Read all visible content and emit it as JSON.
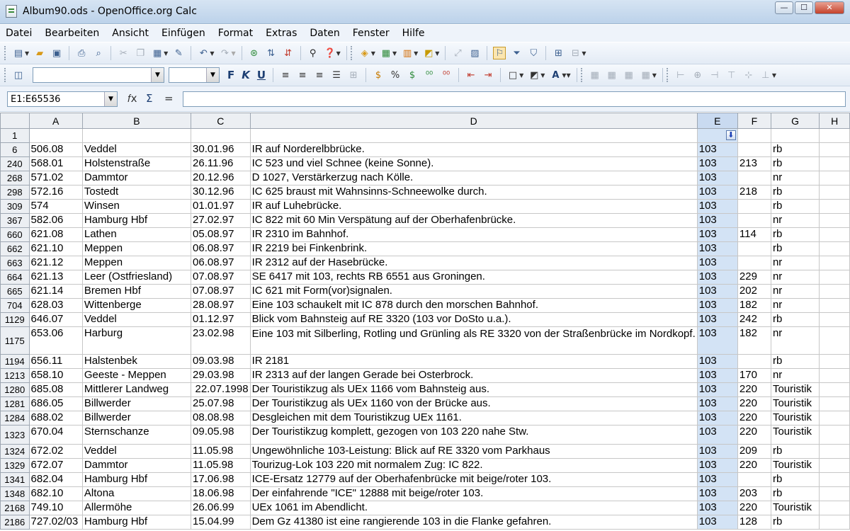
{
  "window": {
    "title": "Album90.ods - OpenOffice.org Calc",
    "min": "—",
    "max": "☐",
    "close": "✕"
  },
  "menu": [
    "Datei",
    "Bearbeiten",
    "Ansicht",
    "Einfügen",
    "Format",
    "Extras",
    "Daten",
    "Fenster",
    "Hilfe"
  ],
  "format": {
    "bold": "F",
    "italic": "K",
    "underline": "U"
  },
  "namebox": "E1:E65536",
  "formula": {
    "fx": "𝑓x",
    "sum": "Σ",
    "equals": "="
  },
  "columns": [
    "A",
    "B",
    "C",
    "D",
    "E",
    "F",
    "G",
    "H"
  ],
  "rows": [
    {
      "n": "1",
      "a": "",
      "b": "",
      "c": "",
      "d": "",
      "e": "",
      "f": "",
      "g": ""
    },
    {
      "n": "6",
      "a": "506.08",
      "b": "Veddel",
      "c": "30.01.96",
      "d": "IR auf Norderelbbrücke.",
      "e": "103",
      "f": "",
      "g": "rb"
    },
    {
      "n": "240",
      "a": "568.01",
      "b": "Holstenstraße",
      "c": "26.11.96",
      "d": "IC 523 und viel Schnee (keine Sonne).",
      "e": "103",
      "f": "213",
      "g": "rb"
    },
    {
      "n": "268",
      "a": "571.02",
      "b": "Dammtor",
      "c": "20.12.96",
      "d": "D 1027, Verstärkerzug nach Kölle.",
      "e": "103",
      "f": "",
      "g": "nr"
    },
    {
      "n": "298",
      "a": "572.16",
      "b": "Tostedt",
      "c": "30.12.96",
      "d": "IC 625 braust mit Wahnsinns-Schneewolke durch.",
      "e": "103",
      "f": "218",
      "g": "rb"
    },
    {
      "n": "309",
      "a": "574",
      "b": "Winsen",
      "c": "01.01.97",
      "d": "IR auf Luhebrücke.",
      "e": "103",
      "f": "",
      "g": "rb"
    },
    {
      "n": "367",
      "a": "582.06",
      "b": "Hamburg Hbf",
      "c": "27.02.97",
      "d": "IC 822 mit 60 Min Verspätung auf der Oberhafenbrücke.",
      "e": "103",
      "f": "",
      "g": "nr"
    },
    {
      "n": "660",
      "a": "621.08",
      "b": "Lathen",
      "c": "05.08.97",
      "d": "IR 2310 im Bahnhof.",
      "e": "103",
      "f": "114",
      "g": "rb"
    },
    {
      "n": "662",
      "a": "621.10",
      "b": "Meppen",
      "c": "06.08.97",
      "d": "IR 2219 bei Finkenbrink.",
      "e": "103",
      "f": "",
      "g": "rb"
    },
    {
      "n": "663",
      "a": "621.12",
      "b": "Meppen",
      "c": "06.08.97",
      "d": "IR 2312 auf der Hasebrücke.",
      "e": "103",
      "f": "",
      "g": "nr"
    },
    {
      "n": "664",
      "a": "621.13",
      "b": "Leer (Ostfriesland)",
      "c": "07.08.97",
      "d": "SE 6417 mit 103, rechts RB 6551 aus Groningen.",
      "e": "103",
      "f": "229",
      "g": "nr"
    },
    {
      "n": "665",
      "a": "621.14",
      "b": "Bremen Hbf",
      "c": "07.08.97",
      "d": "IC 621 mit Form(vor)signalen.",
      "e": "103",
      "f": "202",
      "g": "nr"
    },
    {
      "n": "704",
      "a": "628.03",
      "b": "Wittenberge",
      "c": "28.08.97",
      "d": "Eine 103 schaukelt mit IC 878 durch den morschen Bahnhof.",
      "e": "103",
      "f": "182",
      "g": "nr"
    },
    {
      "n": "1129",
      "a": "646.07",
      "b": "Veddel",
      "c": "01.12.97",
      "d": "Blick vom Bahnsteig auf RE 3320 (103 vor DoSto u.a.).",
      "e": "103",
      "f": "242",
      "g": "rb"
    },
    {
      "n": "1175",
      "a": "653.06",
      "b": "Harburg",
      "c": "23.02.98",
      "d": "Eine 103 mit Silberling, Rotling und Grünling als RE 3320 von der Straßenbrücke im Nordkopf.",
      "e": "103",
      "f": "182",
      "g": "nr",
      "tall": true
    },
    {
      "n": "1194",
      "a": "656.11",
      "b": "Halstenbek",
      "c": "09.03.98",
      "d": "IR 2181",
      "e": "103",
      "f": "",
      "g": "rb"
    },
    {
      "n": "1213",
      "a": "658.10",
      "b": "Geeste - Meppen",
      "c": "29.03.98",
      "d": "IR 2313 auf der langen Gerade bei Osterbrock.",
      "e": "103",
      "f": "170",
      "g": "nr"
    },
    {
      "n": "1280",
      "a": "685.08",
      "b": "Mittlerer Landweg",
      "c": "22.07.1998",
      "d": "Der Touristikzug als UEx 1166 vom Bahnsteig aus.",
      "e": "103",
      "f": "220",
      "g": "Touristik",
      "cright": true
    },
    {
      "n": "1281",
      "a": "686.05",
      "b": "Billwerder",
      "c": "25.07.98",
      "d": "Der Touristikzug als UEx 1160  von der Brücke aus.",
      "e": "103",
      "f": "220",
      "g": "Touristik"
    },
    {
      "n": "1284",
      "a": "688.02",
      "b": "Billwerder",
      "c": "08.08.98",
      "d": "Desgleichen mit dem Touristikzug UEx 1161.",
      "e": "103",
      "f": "220",
      "g": "Touristik"
    },
    {
      "n": "1323",
      "a": "670.04",
      "b": "Sternschanze",
      "c": "09.05.98",
      "d": "Der Touristikzug komplett, gezogen von 103 220 nahe Stw.",
      "e": "103",
      "f": "220",
      "g": "Touristik",
      "mid": true
    },
    {
      "n": "1324",
      "a": "672.02",
      "b": "Veddel",
      "c": "11.05.98",
      "d": "Ungewöhnliche 103-Leistung: Blick auf RE 3320 vom Parkhaus",
      "e": "103",
      "f": "209",
      "g": "rb"
    },
    {
      "n": "1329",
      "a": "672.07",
      "b": "Dammtor",
      "c": "11.05.98",
      "d": "Tourizug-Lok 103 220 mit normalem Zug: IC 822.",
      "e": "103",
      "f": "220",
      "g": "Touristik"
    },
    {
      "n": "1341",
      "a": "682.04",
      "b": "Hamburg Hbf",
      "c": "17.06.98",
      "d": "ICE-Ersatz 12779 auf der Oberhafenbrücke mit beige/roter 103.",
      "e": "103",
      "f": "",
      "g": "rb"
    },
    {
      "n": "1348",
      "a": "682.10",
      "b": "Altona",
      "c": "18.06.98",
      "d": "Der einfahrende \"ICE\" 12888 mit beige/roter 103.",
      "e": "103",
      "f": "203",
      "g": "rb"
    },
    {
      "n": "2168",
      "a": "749.10",
      "b": "Allermöhe",
      "c": "26.06.99",
      "d": "UEx 1061 im Abendlicht.",
      "e": "103",
      "f": "220",
      "g": "Touristik"
    },
    {
      "n": "2186",
      "a": "727.02/03",
      "b": "Hamburg Hbf",
      "c": "15.04.99",
      "d": "Dem Gz 41380 ist eine rangierende 103 in die Flanke gefahren.",
      "e": "103",
      "f": "128",
      "g": "rb"
    }
  ]
}
